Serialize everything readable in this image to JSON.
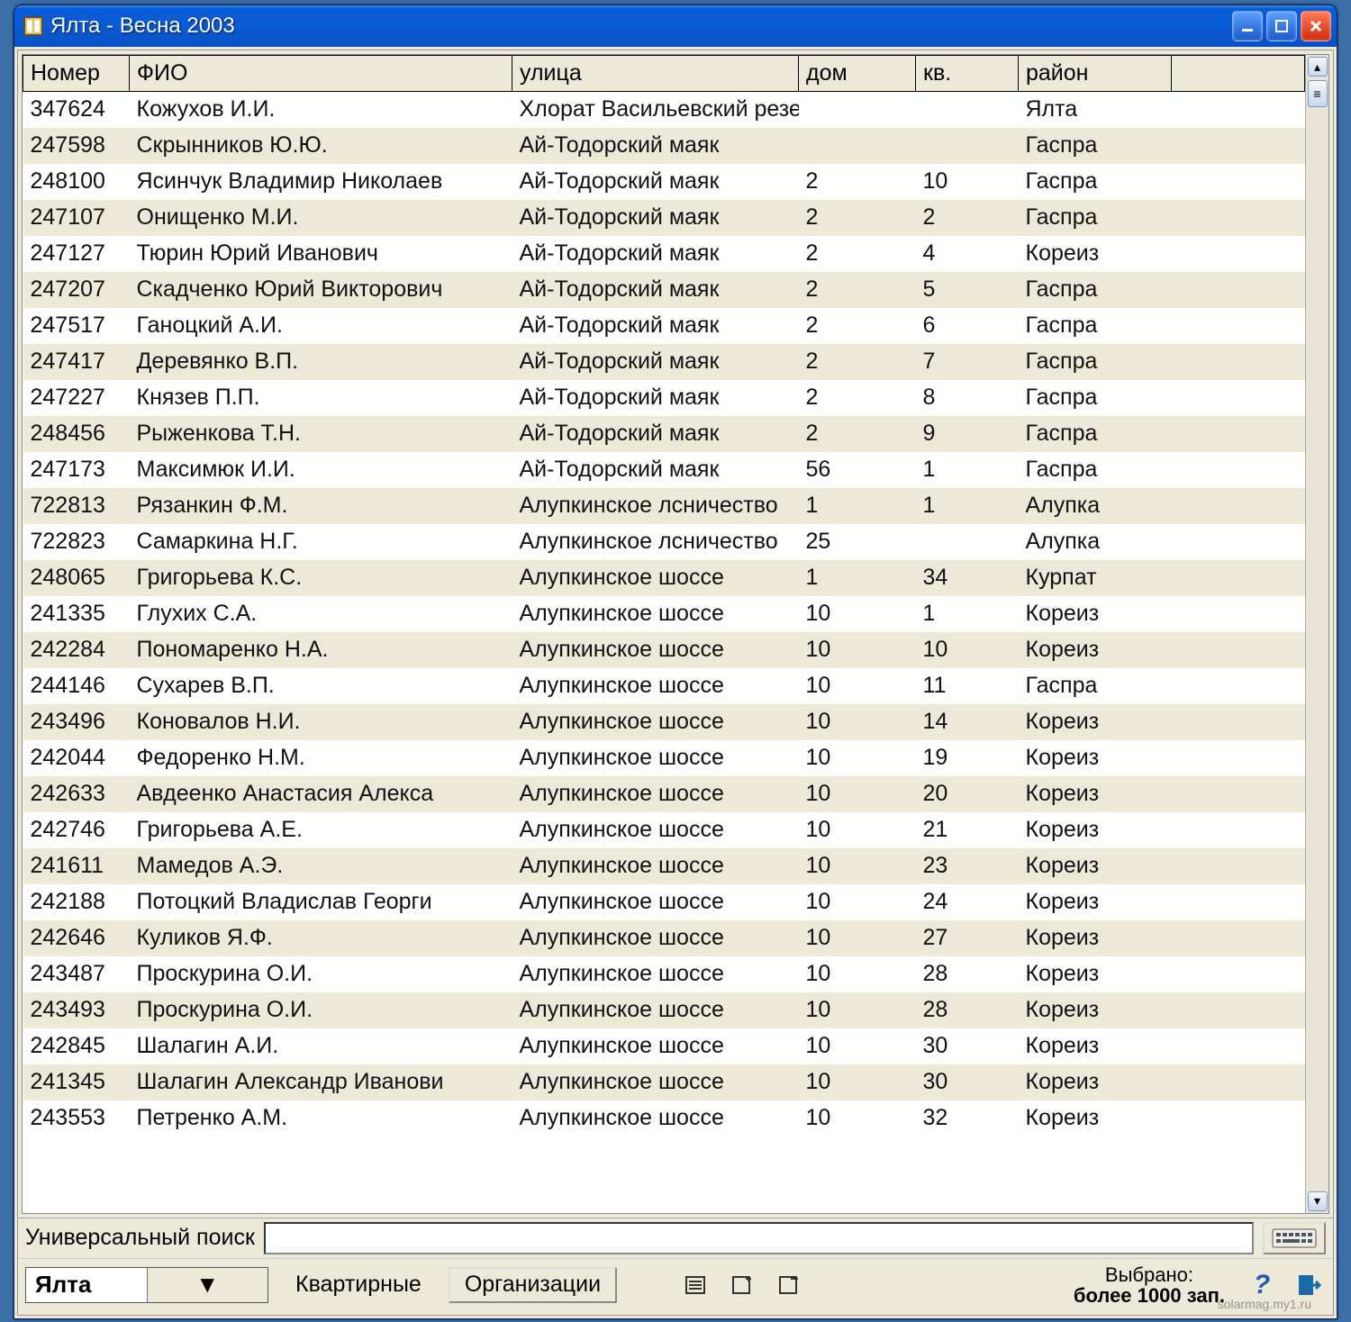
{
  "window": {
    "title": "Ялта  - Весна 2003"
  },
  "columns": {
    "number": "Номер",
    "fio": "ФИО",
    "street": "улица",
    "house": "дом",
    "apt": "кв.",
    "region": "район"
  },
  "rows": [
    {
      "n": "347624",
      "fio": "Кожухов И.И.",
      "street": " Хлорат Васильевский резер",
      "house": "",
      "apt": "",
      "region": "Ялта"
    },
    {
      "n": "247598",
      "fio": "Скрынников Ю.Ю.",
      "street": "Ай-Тодорский маяк",
      "house": "",
      "apt": "",
      "region": "Гаспра"
    },
    {
      "n": "248100",
      "fio": "Ясинчук Владимир Николаев",
      "street": "Ай-Тодорский маяк",
      "house": "2",
      "apt": "10",
      "region": "Гаспра"
    },
    {
      "n": "247107",
      "fio": "Онищенко М.И.",
      "street": "Ай-Тодорский маяк",
      "house": "2",
      "apt": "2",
      "region": "Гаспра"
    },
    {
      "n": "247127",
      "fio": "Тюрин Юрий Иванович",
      "street": "Ай-Тодорский маяк",
      "house": "2",
      "apt": "4",
      "region": "Кореиз"
    },
    {
      "n": "247207",
      "fio": "Скадченко Юрий Викторович",
      "street": "Ай-Тодорский маяк",
      "house": "2",
      "apt": "5",
      "region": "Гаспра"
    },
    {
      "n": "247517",
      "fio": "Ганоцкий А.И.",
      "street": "Ай-Тодорский маяк",
      "house": "2",
      "apt": "6",
      "region": "Гаспра"
    },
    {
      "n": "247417",
      "fio": "Деревянко В.П.",
      "street": "Ай-Тодорский маяк",
      "house": "2",
      "apt": "7",
      "region": "Гаспра"
    },
    {
      "n": "247227",
      "fio": "Князев П.П.",
      "street": "Ай-Тодорский маяк",
      "house": "2",
      "apt": "8",
      "region": "Гаспра"
    },
    {
      "n": "248456",
      "fio": "Рыженкова Т.Н.",
      "street": "Ай-Тодорский маяк",
      "house": "2",
      "apt": "9",
      "region": "Гаспра"
    },
    {
      "n": "247173",
      "fio": "Максимюк И.И.",
      "street": "Ай-Тодорский маяк",
      "house": "56",
      "apt": "1",
      "region": "Гаспра"
    },
    {
      "n": "722813",
      "fio": "Рязанкин Ф.М.",
      "street": "Алупкинское лсничество",
      "house": "1",
      "apt": "1",
      "region": "Алупка"
    },
    {
      "n": "722823",
      "fio": "Самаркина Н.Г.",
      "street": "Алупкинское лсничество",
      "house": "25",
      "apt": "",
      "region": "Алупка"
    },
    {
      "n": "248065",
      "fio": "Григорьева К.С.",
      "street": "Алупкинское шоссе",
      "house": "1",
      "apt": "34",
      "region": "Курпат"
    },
    {
      "n": "241335",
      "fio": "Глухих С.А.",
      "street": "Алупкинское шоссе",
      "house": "10",
      "apt": "1",
      "region": "Кореиз"
    },
    {
      "n": "242284",
      "fio": "Пономаренко Н.А.",
      "street": "Алупкинское шоссе",
      "house": "10",
      "apt": "10",
      "region": "Кореиз"
    },
    {
      "n": "244146",
      "fio": "Сухарев В.П.",
      "street": "Алупкинское шоссе",
      "house": "10",
      "apt": "11",
      "region": "Гаспра"
    },
    {
      "n": "243496",
      "fio": "Коновалов Н.И.",
      "street": "Алупкинское шоссе",
      "house": "10",
      "apt": "14",
      "region": "Кореиз"
    },
    {
      "n": "242044",
      "fio": "Федоренко Н.М.",
      "street": "Алупкинское шоссе",
      "house": "10",
      "apt": "19",
      "region": "Кореиз"
    },
    {
      "n": "242633",
      "fio": "Авдеенко Анастасия Алекса",
      "street": "Алупкинское шоссе",
      "house": "10",
      "apt": "20",
      "region": "Кореиз"
    },
    {
      "n": "242746",
      "fio": "Григорьева А.Е.",
      "street": "Алупкинское шоссе",
      "house": "10",
      "apt": "21",
      "region": "Кореиз"
    },
    {
      "n": "241611",
      "fio": "Мамедов А.Э.",
      "street": "Алупкинское шоссе",
      "house": "10",
      "apt": "23",
      "region": "Кореиз"
    },
    {
      "n": "242188",
      "fio": "Потоцкий Владислав Георги",
      "street": "Алупкинское шоссе",
      "house": "10",
      "apt": "24",
      "region": "Кореиз"
    },
    {
      "n": "242646",
      "fio": "Куликов Я.Ф.",
      "street": "Алупкинское шоссе",
      "house": "10",
      "apt": "27",
      "region": "Кореиз"
    },
    {
      "n": "243487",
      "fio": "Проскурина О.И.",
      "street": "Алупкинское шоссе",
      "house": "10",
      "apt": "28",
      "region": "Кореиз"
    },
    {
      "n": "243493",
      "fio": "Проскурина О.И.",
      "street": "Алупкинское шоссе",
      "house": "10",
      "apt": "28",
      "region": "Кореиз"
    },
    {
      "n": "242845",
      "fio": "Шалагин А.И.",
      "street": "Алупкинское шоссе",
      "house": "10",
      "apt": "30",
      "region": "Кореиз"
    },
    {
      "n": "241345",
      "fio": "Шалагин Александр Иванови",
      "street": "Алупкинское шоссе",
      "house": "10",
      "apt": "30",
      "region": "Кореиз"
    },
    {
      "n": "243553",
      "fio": "Петренко А.М.",
      "street": "Алупкинское шоссе",
      "house": "10",
      "apt": "32",
      "region": "Кореиз"
    }
  ],
  "search": {
    "label": "Универсальный поиск",
    "value": ""
  },
  "bottom": {
    "region_selected": "Ялта",
    "btn_apartments": "Квартирные",
    "btn_orgs": "Организации",
    "selected_label": "Выбрано:",
    "selected_value": "более 1000 зап."
  },
  "watermark": "solarmag.my1.ru"
}
